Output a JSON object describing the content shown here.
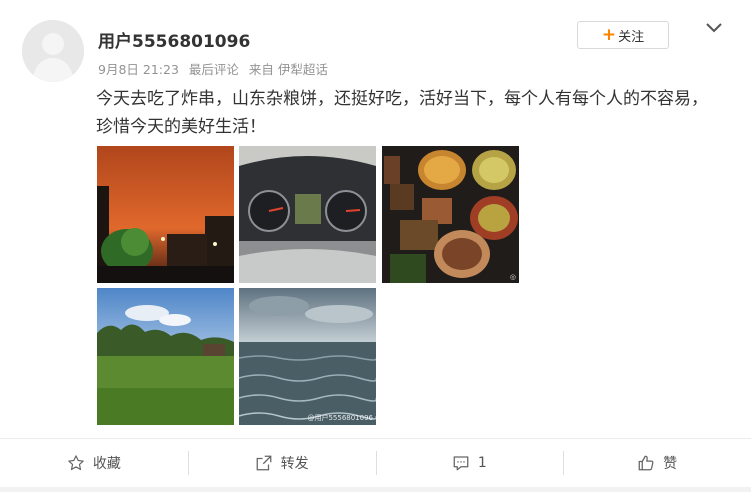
{
  "post": {
    "username": "用户5556801096",
    "time": "9月8日 21:23",
    "edited": "最后评论",
    "source": "来自 伊犁超话",
    "text": "今天去吃了炸串，山东杂粮饼，还挺好吃，活好当下，每个人有每个人的不容易，珍惜今天的美好生活！",
    "follow_label": "关注",
    "follow_plus": "+",
    "photo_watermark": "@用户5556801096"
  },
  "actions": {
    "favorite": "收藏",
    "repost": "转发",
    "comment": "1",
    "like": "赞"
  },
  "colors": {
    "accent": "#ff8200",
    "text": "#333333",
    "meta": "#939393"
  },
  "icons": [
    "avatar-placeholder",
    "chevron-down-icon",
    "star-icon",
    "share-icon",
    "comment-icon",
    "thumbs-up-icon"
  ]
}
